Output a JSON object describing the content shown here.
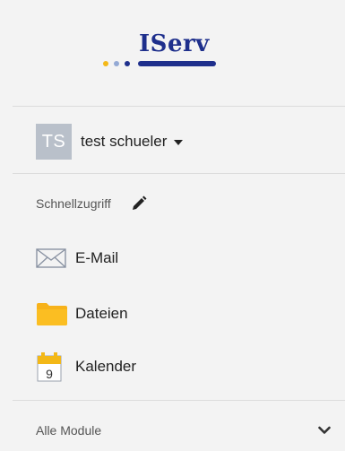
{
  "brand": {
    "name": "IServ",
    "dot_colors": [
      "#f3b817",
      "#93a9d4",
      "#1e2f8c"
    ],
    "color": "#1e2f8c"
  },
  "user": {
    "initials": "TS",
    "name": "test schueler"
  },
  "quick_access": {
    "label": "Schnellzugriff",
    "items": [
      {
        "label": "E-Mail",
        "icon": "envelope-icon"
      },
      {
        "label": "Dateien",
        "icon": "folder-icon"
      },
      {
        "label": "Kalender",
        "icon": "calendar-icon",
        "icon_number": "9"
      }
    ]
  },
  "modules": {
    "label": "Alle Module"
  }
}
